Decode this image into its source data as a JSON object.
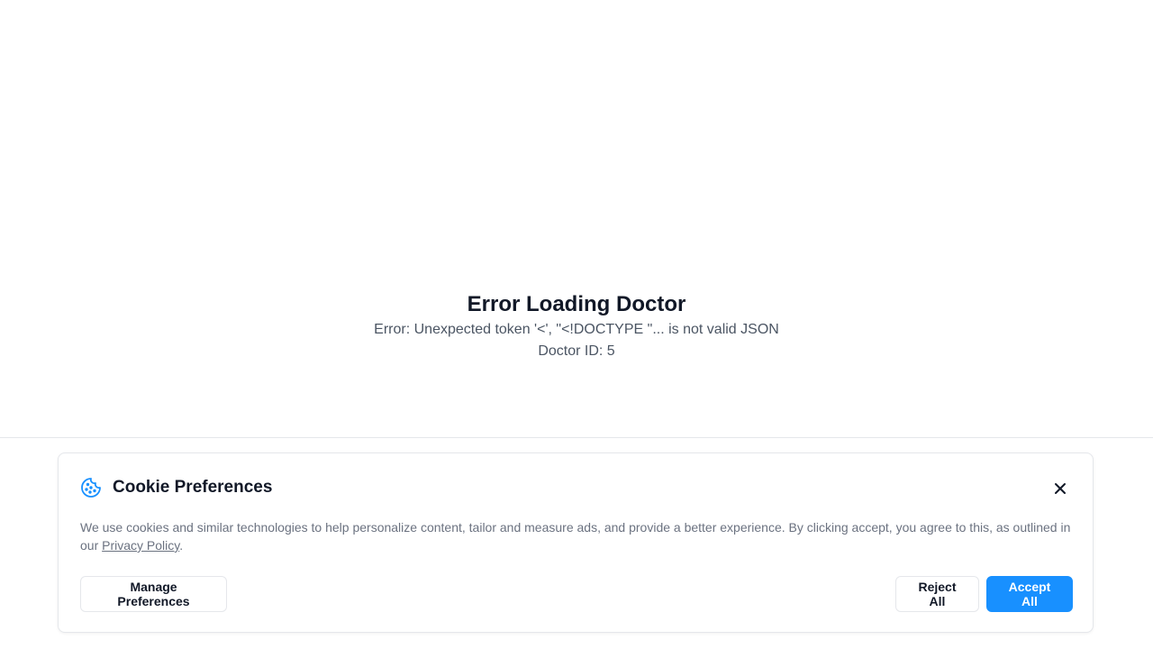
{
  "error": {
    "title": "Error Loading Doctor",
    "message": "Error: Unexpected token '<', \"<!DOCTYPE \"... is not valid JSON",
    "doctor_id": "Doctor ID: 5"
  },
  "cookie_banner": {
    "title": "Cookie Preferences",
    "icon": "cookie-icon",
    "body_text": "We use cookies and similar technologies to help personalize content, tailor and measure ads, and provide a better experience. By clicking accept, you agree to this, as outlined in our ",
    "privacy_link": "Privacy Policy",
    "body_end": ".",
    "manage_label": "Manage Preferences",
    "reject_label": "Reject All",
    "accept_label": "Accept All",
    "close_icon": "close-icon",
    "accent_color": "#1890ff"
  }
}
